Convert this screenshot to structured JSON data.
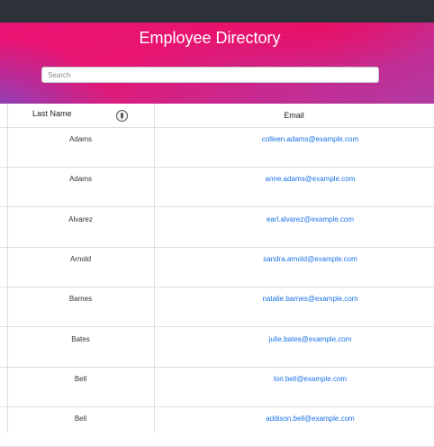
{
  "header": {
    "title": "Employee Directory",
    "search_placeholder": "Search"
  },
  "table": {
    "columns": [
      "Last Name",
      "Email"
    ],
    "sort_icon": "sort-updown-icon",
    "rows": [
      {
        "last_name": "Adams",
        "email": "colleen.adams@example.com"
      },
      {
        "last_name": "Adams",
        "email": "anne.adams@example.com"
      },
      {
        "last_name": "Alvarez",
        "email": "earl.alvarez@example.com"
      },
      {
        "last_name": "Arnold",
        "email": "sandra.arnold@example.com"
      },
      {
        "last_name": "Barnes",
        "email": "natalie.barnes@example.com"
      },
      {
        "last_name": "Bates",
        "email": "julie.bates@example.com"
      },
      {
        "last_name": "Bell",
        "email": "lori.bell@example.com"
      },
      {
        "last_name": "Bell",
        "email": "addison.bell@example.com"
      }
    ]
  },
  "colors": {
    "link": "#1a73e8",
    "topbar": "#2d3238",
    "hero_primary": "#ea1474",
    "hero_accent": "#6e50d2"
  }
}
